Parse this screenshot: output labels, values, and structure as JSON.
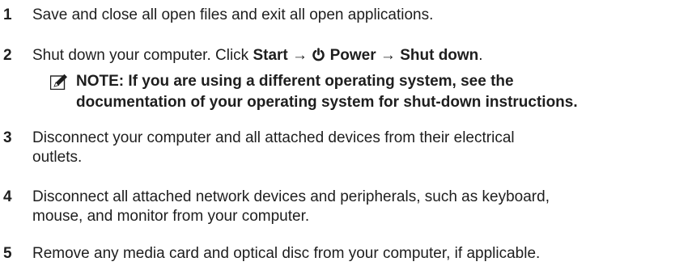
{
  "steps": [
    {
      "number": "1",
      "text": "Save and close all open files and exit all open applications."
    },
    {
      "number": "2",
      "pre": "Shut down your computer. Click ",
      "start": "Start",
      "arrow1": " → ",
      "power": " Power",
      "arrow2": " → ",
      "shutdown": "Shut down",
      "end": "."
    },
    {
      "number": "3",
      "line1": "Disconnect your computer and all attached devices from their electrical",
      "line2": "outlets."
    },
    {
      "number": "4",
      "line1": "Disconnect all attached network devices and peripherals, such as keyboard,",
      "line2": "mouse, and monitor from your computer."
    },
    {
      "number": "5",
      "text": "Remove any media card and optical disc from your computer, if applicable."
    }
  ],
  "note": {
    "icon": "pencil-note-icon",
    "line1": "NOTE: If you are using a different operating system, see the",
    "line2": "documentation of your operating system for shut-down instructions."
  }
}
